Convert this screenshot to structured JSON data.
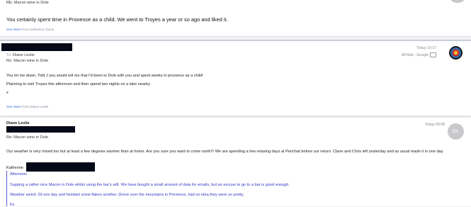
{
  "messages": [
    {
      "subject": "RE: Macon wine in Dole",
      "body": "You certainly spent time in Provence as a child.  We went to Troyes a year or so ago and liked it.",
      "see_more": "See More",
      "see_more_from": "from Katherine Clune"
    },
    {
      "to_label": "To:",
      "to_name": "Diane Leslie",
      "subject": "Re: Macon wine in Dole",
      "date": "Today 10:17",
      "folder": "All Mail - Google",
      "body_lines": [
        "You let me down.  Told J you would tell me that I'd been to Dole with you and spent weeks in provence as a child!",
        "Planning to visit Troyes this afternoon and then spend two nights on a lake nearby.",
        "x"
      ],
      "see_more": "See More",
      "see_more_from": "from Diane Leslie"
    },
    {
      "from": "Diane Leslie",
      "subject": "Re: Macon wine in Dole",
      "date": "Today 09:08",
      "avatar_initials": "DL",
      "body": "Our weather is very mixed too but at least a few degrees warmer than at home.  Are you sure you want to come north!!!  We are spending a few relaxing days at Perichat before our return.  Claire and Chris left yesterday and as usual made it in one day.",
      "sig_prefix": "Katherine",
      "quote": [
        "Afternoon",
        "Supping a rather nice Macon in Dole whilst using the bar's wifi.  We have bought a small amount of data for emails, but an excuse to go to a bar is good enough.",
        "Weather weird- 29 one day and hesitant snow flakes another.  Drove over the mountains in Provence, had no idea they were so pretty.",
        "Kx"
      ]
    }
  ],
  "colors": {
    "link": "#3b6fd3",
    "quote": "#3838c8",
    "redaction": "#060a18",
    "background": "#f2f2f4"
  },
  "icons": [
    "folder-icon",
    "sender-logo",
    "avatar"
  ]
}
